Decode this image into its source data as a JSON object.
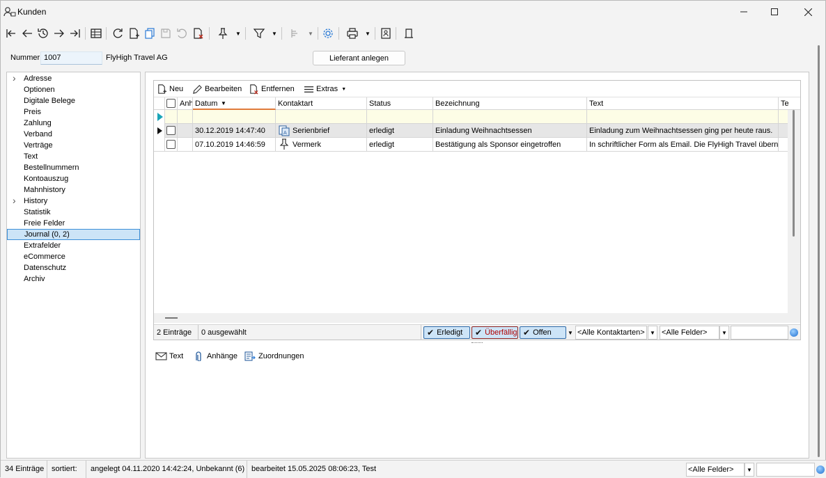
{
  "window": {
    "title": "Kunden",
    "controls": [
      "minimize-icon",
      "maximize-icon",
      "close-icon"
    ]
  },
  "toolbar": {
    "icons": [
      "first-record-icon",
      "previous-record-icon",
      "history-icon",
      "next-record-icon",
      "last-record-icon",
      "table-view-icon",
      "refresh-icon",
      "new-document-icon",
      "copy-icon",
      "save-icon",
      "undo-icon",
      "delete-icon",
      "pin-icon",
      "filter-icon",
      "sort-icon",
      "settings-icon",
      "print-icon",
      "contact-card-icon",
      "bookmark-icon"
    ]
  },
  "record": {
    "number_label": "Nummer",
    "number_value": "1007",
    "name": "FlyHigh Travel AG",
    "supplier_button": "Lieferant anlegen"
  },
  "tree": {
    "items": [
      {
        "label": "Adresse",
        "expandable": true
      },
      {
        "label": "Optionen"
      },
      {
        "label": "Digitale Belege"
      },
      {
        "label": "Preis"
      },
      {
        "label": "Zahlung"
      },
      {
        "label": "Verband"
      },
      {
        "label": "Verträge"
      },
      {
        "label": "Text"
      },
      {
        "label": "Bestellnummern"
      },
      {
        "label": "Kontoauszug"
      },
      {
        "label": "Mahnhistory"
      },
      {
        "label": "History",
        "expandable": true
      },
      {
        "label": "Statistik"
      },
      {
        "label": "Freie Felder"
      },
      {
        "label": "Journal (0, 2)",
        "selected": true
      },
      {
        "label": "Extrafelder"
      },
      {
        "label": "eCommerce"
      },
      {
        "label": "Datenschutz"
      },
      {
        "label": "Archiv"
      }
    ]
  },
  "grid": {
    "toolbar": {
      "new": "Neu",
      "edit": "Bearbeiten",
      "remove": "Entfernen",
      "extras": "Extras"
    },
    "columns": {
      "attachments": "Anh.",
      "date": "Datum",
      "contact_type": "Kontaktart",
      "status": "Status",
      "designation": "Bezeichnung",
      "text": "Text",
      "more": "Te"
    },
    "rows": [
      {
        "date": "30.12.2019 14:47:40",
        "contact_type": "Serienbrief",
        "contact_icon": "serial-letter-icon",
        "status": "erledigt",
        "designation": "Einladung Weihnachtsessen",
        "text": "Einladung zum Weihnachtsessen ging per heute raus."
      },
      {
        "date": "07.10.2019 14:46:59",
        "contact_type": "Vermerk",
        "contact_icon": "pin-icon",
        "status": "erledigt",
        "designation": "Bestätigung als Sponsor eingetroffen",
        "text": "In schriftlicher Form als Email. Die FlyHigh Travel übernimm"
      }
    ],
    "footer": {
      "count": "2 Einträge",
      "selected": "0 ausgewählt",
      "filter_done": "Erledigt",
      "filter_overdue": "Überfällig",
      "filter_open": "Offen",
      "contact_types": "<Alle Kontaktarten>",
      "fields": "<Alle Felder>",
      "search_value": ""
    }
  },
  "bottom_tabs": {
    "text": "Text",
    "attachments": "Anhänge",
    "assignments": "Zuordnungen"
  },
  "statusbar": {
    "count": "34 Einträge",
    "sorted": "sortiert:",
    "created": "angelegt 04.11.2020 14:42:24, Unbekannt (6)",
    "edited": "bearbeitet 15.05.2025 08:06:23, Test",
    "fields": "<Alle Felder>",
    "search_value": ""
  },
  "colors": {
    "selection_bg": "#cce4f7",
    "selection_border": "#3c8fd8",
    "sort_accent": "#e07a3a",
    "overdue_text": "#b00000",
    "new_row_bg": "#fdfde6"
  }
}
